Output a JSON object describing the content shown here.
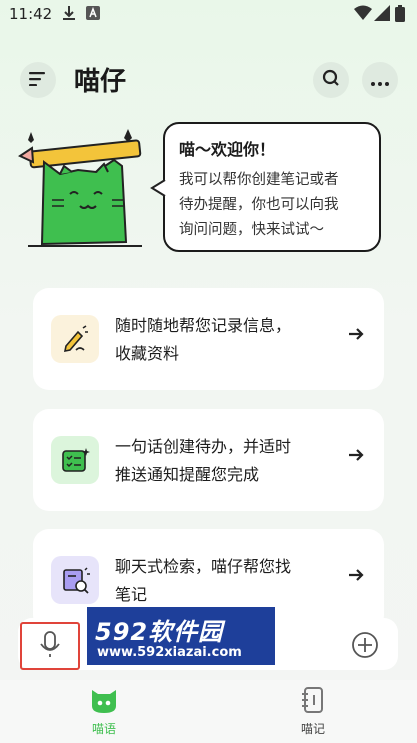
{
  "status_bar": {
    "time": "11:42"
  },
  "header": {
    "title": "喵仔"
  },
  "hero": {
    "bubble_title": "喵～欢迎你！",
    "bubble_lines": [
      "我可以帮你创建笔记或者",
      "待办提醒，你也可以向我",
      "询问问题，快来试试～"
    ]
  },
  "cards": [
    {
      "lines": [
        "随时随地帮您记录信息，",
        "收藏资料"
      ],
      "icon": "pen-note-icon",
      "bg": "#fbf2dc"
    },
    {
      "lines": [
        "一句话创建待办，并适时",
        "推送通知提醒您完成"
      ],
      "icon": "checklist-icon",
      "bg": "#dcf5dc"
    },
    {
      "lines": [
        "聊天式检索，喵仔帮您找",
        "笔记"
      ],
      "icon": "search-doc-icon",
      "bg": "#e7e4fa"
    }
  ],
  "watermark": {
    "logo": "592软件园",
    "url": "www.592xiazai.com"
  },
  "tabs": [
    {
      "label": "喵语",
      "active": true,
      "icon": "cat-face-icon"
    },
    {
      "label": "喵记",
      "active": false,
      "icon": "notebook-icon"
    }
  ],
  "colors": {
    "accent": "#3fbf4f",
    "highlight": "#e0443a",
    "watermark_bg": "#1e3f9a"
  }
}
